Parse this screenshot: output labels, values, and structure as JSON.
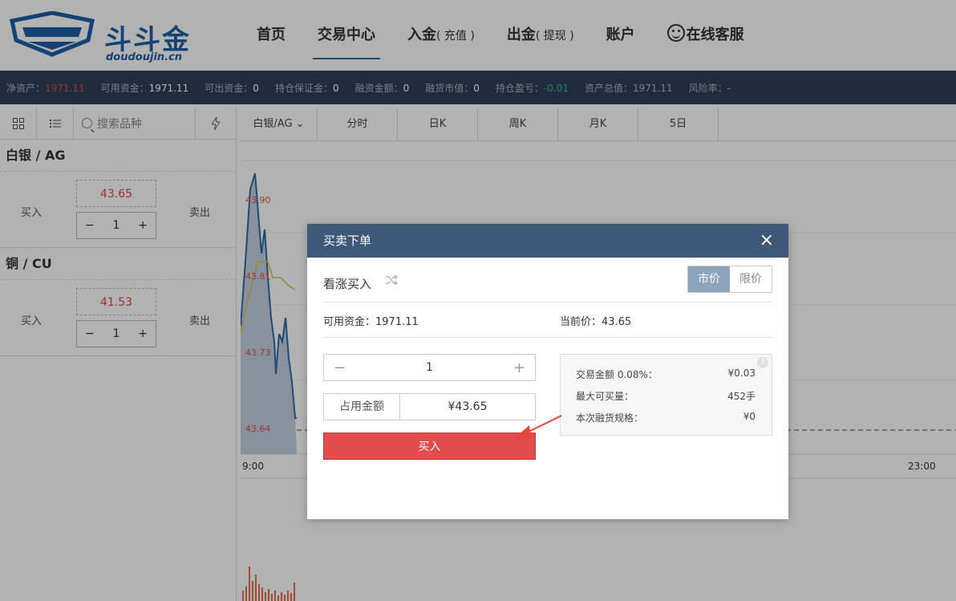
{
  "brand": {
    "name": "斗斗金",
    "sub": "doudoujin.cn"
  },
  "nav": [
    {
      "label": "首页",
      "small": ""
    },
    {
      "label": "交易中心",
      "small": ""
    },
    {
      "label": "入金",
      "small": "( 充值 )"
    },
    {
      "label": "出金",
      "small": "( 提现 )"
    },
    {
      "label": "账户",
      "small": ""
    },
    {
      "label": "在线客服",
      "small": ""
    }
  ],
  "stats": [
    {
      "label": "净资产：",
      "value": "1971.11",
      "color": "red"
    },
    {
      "label": "可用资金：",
      "value": "1971.11",
      "color": "white"
    },
    {
      "label": "可出资金：",
      "value": "0",
      "color": "white"
    },
    {
      "label": "持仓保证金：",
      "value": "0",
      "color": "white"
    },
    {
      "label": "融资金额：",
      "value": "0",
      "color": "white"
    },
    {
      "label": "融货市值：",
      "value": "0",
      "color": "white"
    },
    {
      "label": "持仓盈亏：",
      "value": "-0.01",
      "color": "green"
    },
    {
      "label": "资产总值：",
      "value": "1971.11",
      "color": "dim"
    },
    {
      "label": "风险率：",
      "value": "-",
      "color": "dim"
    }
  ],
  "left": {
    "search_placeholder": "搜索品种",
    "products": [
      {
        "title": "白银 / AG",
        "buy": "买入",
        "sell": "卖出",
        "price": "43.65",
        "qty": "1"
      },
      {
        "title": "铜 / CU",
        "buy": "买入",
        "sell": "卖出",
        "price": "41.53",
        "qty": "1"
      }
    ]
  },
  "chart_tabs": [
    "白银/AG",
    "分时",
    "日K",
    "周K",
    "月K",
    "5日"
  ],
  "chart_data": {
    "type": "line",
    "y_labels": [
      "43.90",
      "43.81",
      "43.73",
      "43.64"
    ],
    "x_labels": [
      "9:00",
      "23:00"
    ],
    "series": [
      {
        "values": [
          43.75,
          43.8,
          43.92,
          43.88,
          43.85,
          43.78,
          43.84,
          43.72,
          43.74,
          43.7,
          43.68,
          43.66
        ]
      }
    ]
  },
  "modal": {
    "title": "买卖下单",
    "close": "×",
    "direction": "看涨买入",
    "seg_market": "市价",
    "seg_limit": "限价",
    "available_label": "可用资金：",
    "available_value": "1971.11",
    "price_label": "当前价：",
    "price_value": "43.65",
    "qty": "1",
    "amount_label": "占用金额",
    "amount_value": "¥43.65",
    "buy_button": "买入",
    "info": [
      {
        "label": "交易金额 0.08%：",
        "value": "¥0.03"
      },
      {
        "label": "最大可买量：",
        "value": "452手"
      },
      {
        "label": "本次融货规格：",
        "value": "¥0"
      }
    ]
  }
}
